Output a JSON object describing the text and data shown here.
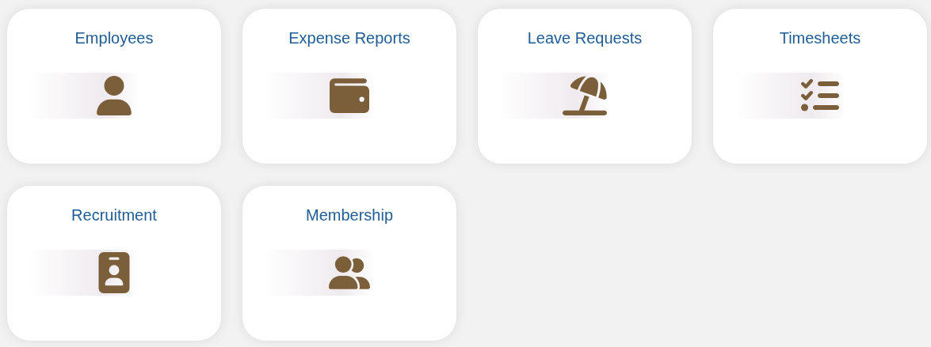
{
  "tiles": [
    {
      "label": "Employees",
      "kind": "person"
    },
    {
      "label": "Expense Reports",
      "kind": "wallet"
    },
    {
      "label": "Leave Requests",
      "kind": "umbrella"
    },
    {
      "label": "Timesheets",
      "kind": "checklist"
    },
    {
      "label": "Recruitment",
      "kind": "badge"
    },
    {
      "label": "Membership",
      "kind": "people"
    }
  ]
}
